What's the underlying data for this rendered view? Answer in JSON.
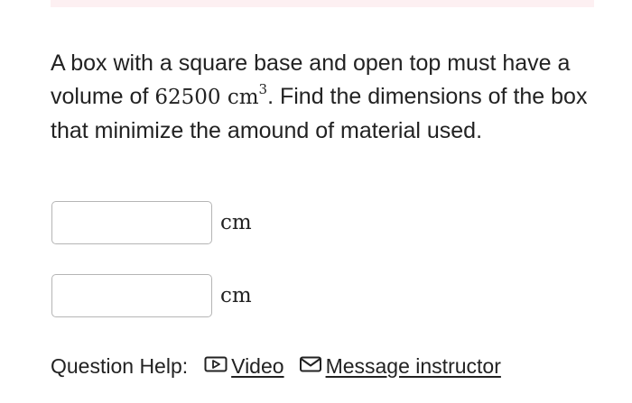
{
  "question": {
    "text_before": "A box with a square base and open top must have a volume of ",
    "volume_value": "62500",
    "volume_unit": "cm",
    "volume_exponent": "3",
    "text_after": ". Find the dimensions of the box that minimize the amound of material used."
  },
  "answers": [
    {
      "value": "",
      "unit": "cm"
    },
    {
      "value": "",
      "unit": "cm"
    }
  ],
  "help": {
    "label": "Question Help:",
    "video_label": "Video",
    "video_icon": "video-play-icon",
    "message_label": "Message instructor",
    "message_icon": "envelope-icon"
  },
  "colors": {
    "banner": "#fdf0f2",
    "text": "#222222",
    "input_border": "#b5b5b5"
  }
}
